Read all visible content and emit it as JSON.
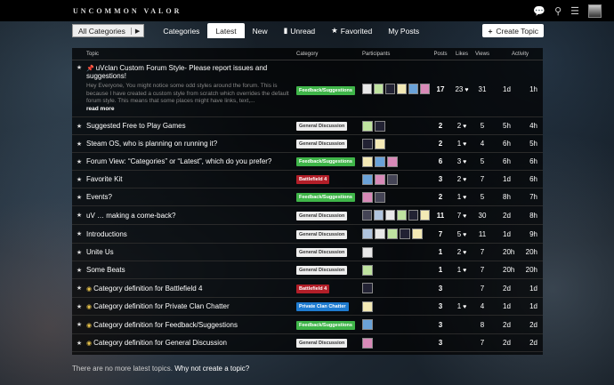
{
  "header": {
    "logo": "UNCOMMON VALOR",
    "icons": [
      "chat-icon",
      "search-icon",
      "menu-icon",
      "avatar"
    ]
  },
  "nav": {
    "category_select": "All Categories",
    "tabs": [
      "Categories",
      "Latest",
      "New",
      "Unread",
      "Favorited",
      "My Posts"
    ],
    "active_tab": "Latest",
    "create_label": "Create Topic"
  },
  "columns": {
    "topic": "Topic",
    "category": "Category",
    "participants": "Participants",
    "posts": "Posts",
    "likes": "Likes",
    "views": "Views",
    "activity": "Activity"
  },
  "categories": {
    "fs": {
      "label": "Feedback/Suggestions",
      "bg": "#3fb549",
      "fg": "#ffffff"
    },
    "gd": {
      "label": "General Discussion",
      "bg": "#eeeeee",
      "fg": "#333333"
    },
    "bf4": {
      "label": "Battlefield 4",
      "bg": "#b21e28",
      "fg": "#ffffff"
    },
    "pcc": {
      "label": "Private Clan Chatter",
      "bg": "#1e7bd0",
      "fg": "#ffffff"
    }
  },
  "topics": [
    {
      "title": "uVclan Custom Forum Style- Please report issues and suggestions!",
      "pinned": true,
      "excerpt": "Hey Everyone, You might notice some odd styles around the forum. This is because I have created a custom style from scratch which overrides the default forum style. This means that some places might have links, text,...",
      "readmore": "read more",
      "cat": "fs",
      "participants": 6,
      "posts": "17",
      "likes": "23",
      "views": "31",
      "created": "1d",
      "last": "1h"
    },
    {
      "title": "Suggested Free to Play Games",
      "cat": "gd",
      "participants": 2,
      "posts": "2",
      "likes": "2",
      "views": "5",
      "created": "5h",
      "last": "4h"
    },
    {
      "title": "Steam OS, who is planning on running it?",
      "cat": "gd",
      "participants": 2,
      "posts": "2",
      "likes": "1",
      "views": "4",
      "created": "6h",
      "last": "5h"
    },
    {
      "title": "Forum View: “Categories” or “Latest”, which do you prefer?",
      "cat": "fs",
      "participants": 3,
      "posts": "6",
      "likes": "3",
      "views": "5",
      "created": "6h",
      "last": "6h"
    },
    {
      "title": "Favorite Kit",
      "cat": "bf4",
      "participants": 3,
      "posts": "3",
      "likes": "2",
      "views": "7",
      "created": "1d",
      "last": "6h"
    },
    {
      "title": "Events?",
      "cat": "fs",
      "participants": 2,
      "posts": "2",
      "likes": "1",
      "views": "5",
      "created": "8h",
      "last": "7h"
    },
    {
      "title": "uV … making a come-back?",
      "cat": "gd",
      "participants": 6,
      "posts": "11",
      "likes": "7",
      "views": "30",
      "created": "2d",
      "last": "8h"
    },
    {
      "title": "Introductions",
      "cat": "gd",
      "participants": 5,
      "posts": "7",
      "likes": "5",
      "views": "11",
      "created": "1d",
      "last": "9h"
    },
    {
      "title": "Unite Us",
      "cat": "gd",
      "participants": 1,
      "posts": "1",
      "likes": "2",
      "views": "7",
      "created": "20h",
      "last": "20h"
    },
    {
      "title": "Some Beats",
      "cat": "gd",
      "participants": 1,
      "posts": "1",
      "likes": "1",
      "views": "7",
      "created": "20h",
      "last": "20h"
    },
    {
      "title": "Category definition for Battlefield 4",
      "category_def": true,
      "cat": "bf4",
      "participants": 1,
      "posts": "3",
      "likes": "",
      "views": "7",
      "created": "2d",
      "last": "1d"
    },
    {
      "title": "Category definition for Private Clan Chatter",
      "category_def": true,
      "cat": "pcc",
      "participants": 1,
      "posts": "3",
      "likes": "1",
      "views": "4",
      "created": "1d",
      "last": "1d"
    },
    {
      "title": "Category definition for Feedback/Suggestions",
      "category_def": true,
      "cat": "fs",
      "participants": 1,
      "posts": "3",
      "likes": "",
      "views": "8",
      "created": "2d",
      "last": "2d"
    },
    {
      "title": "Category definition for General Discussion",
      "category_def": true,
      "cat": "gd",
      "participants": 1,
      "posts": "3",
      "likes": "",
      "views": "7",
      "created": "2d",
      "last": "2d"
    }
  ],
  "footer": {
    "text": "There are no more latest topics.",
    "link": "Why not create a topic?"
  }
}
